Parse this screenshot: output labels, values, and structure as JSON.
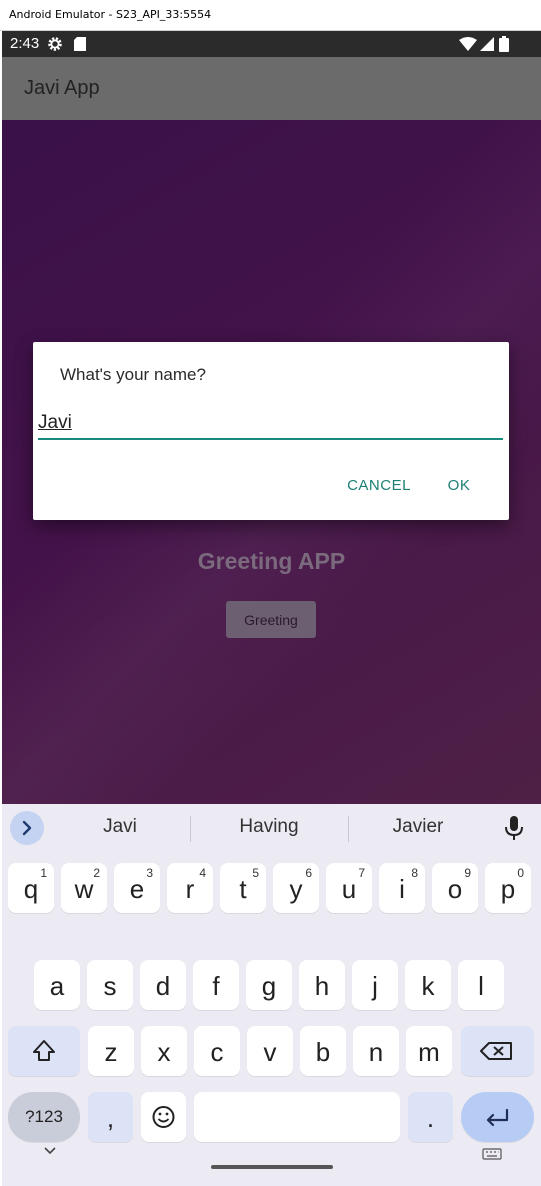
{
  "window": {
    "title": "Android Emulator - S23_API_33:5554"
  },
  "status_bar": {
    "time": "2:43"
  },
  "app_bar": {
    "title": "Javi App"
  },
  "content": {
    "heading": "Greeting APP",
    "button_label": "Greeting"
  },
  "dialog": {
    "title": "What's your name?",
    "input_value": "Javi",
    "cancel_label": "CANCEL",
    "ok_label": "OK",
    "accent_color": "#1b7f73"
  },
  "keyboard": {
    "suggestions": [
      "Javi",
      "Having",
      "Javier"
    ],
    "row1": [
      {
        "key": "q",
        "hint": "1"
      },
      {
        "key": "w",
        "hint": "2"
      },
      {
        "key": "e",
        "hint": "3"
      },
      {
        "key": "r",
        "hint": "4"
      },
      {
        "key": "t",
        "hint": "5"
      },
      {
        "key": "y",
        "hint": "6"
      },
      {
        "key": "u",
        "hint": "7"
      },
      {
        "key": "i",
        "hint": "8"
      },
      {
        "key": "o",
        "hint": "9"
      },
      {
        "key": "p",
        "hint": "0"
      }
    ],
    "row2": [
      "a",
      "s",
      "d",
      "f",
      "g",
      "h",
      "j",
      "k",
      "l"
    ],
    "row3": [
      "z",
      "x",
      "c",
      "v",
      "b",
      "n",
      "m"
    ],
    "symbols_label": "?123",
    "comma_label": ",",
    "period_label": ".",
    "icons": [
      "shift-icon",
      "backspace-icon",
      "emoji-icon",
      "enter-icon",
      "mic-icon",
      "chevron-right-icon"
    ]
  }
}
